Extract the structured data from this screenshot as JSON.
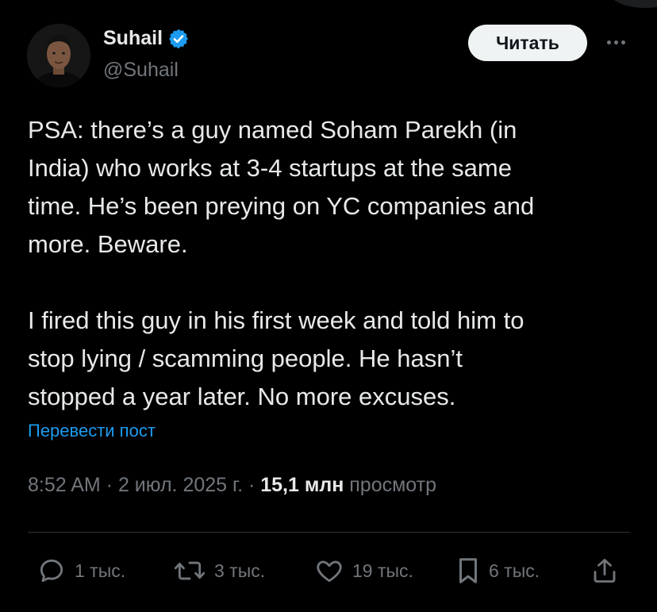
{
  "author": {
    "display_name": "Suhail",
    "handle": "@Suhail",
    "verified": true
  },
  "header": {
    "read_button_label": "Читать",
    "more_icon": "more-horizontal-icon"
  },
  "post": {
    "paragraphs": [
      [
        "PSA: there’s a guy named Soham Parekh (in",
        "India) who works at 3-4 startups at the same",
        "time. He’s been preying on YC companies and",
        "more. Beware."
      ],
      [
        "I fired this guy in his first week and told him to",
        "stop lying / scamming people. He hasn’t",
        "stopped a year later. No more excuses."
      ]
    ],
    "translate_link": "Перевести пост"
  },
  "meta": {
    "time": "8:52 AM",
    "sep1": " · ",
    "date": "2 июл. 2025 г.",
    "sep2": " · ",
    "views_count": "15,1 млн",
    "views_label": " просмотр"
  },
  "actions": {
    "replies": "1 тыс.",
    "reposts": "3 тыс.",
    "likes": "19 тыс.",
    "bookmarks": "6 тыс."
  },
  "colors": {
    "background": "#000000",
    "text": "#e7e9ea",
    "secondary": "#71767b",
    "accent": "#1d9bf0",
    "verified": "#1d9bf0"
  }
}
